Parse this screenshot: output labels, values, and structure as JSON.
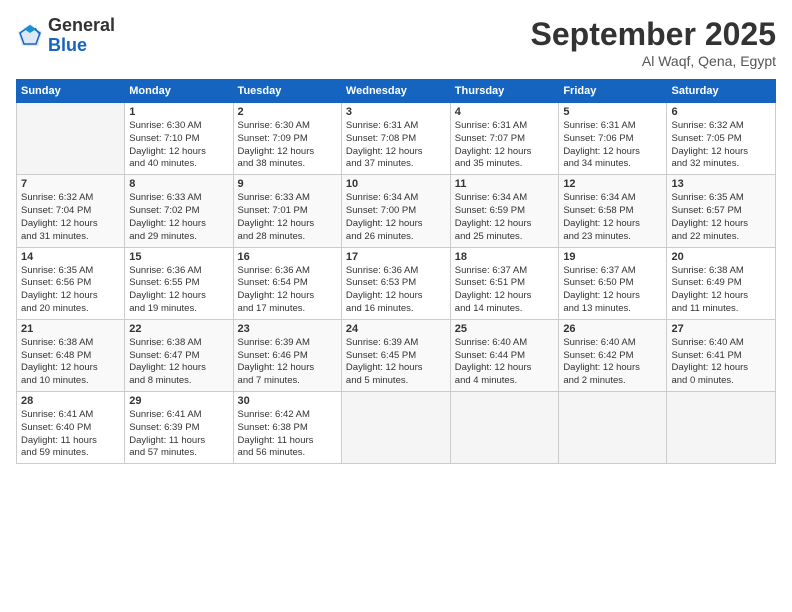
{
  "logo": {
    "general": "General",
    "blue": "Blue"
  },
  "header": {
    "month": "September 2025",
    "location": "Al Waqf, Qena, Egypt"
  },
  "weekdays": [
    "Sunday",
    "Monday",
    "Tuesday",
    "Wednesday",
    "Thursday",
    "Friday",
    "Saturday"
  ],
  "weeks": [
    [
      {
        "day": "",
        "info": ""
      },
      {
        "day": "1",
        "info": "Sunrise: 6:30 AM\nSunset: 7:10 PM\nDaylight: 12 hours\nand 40 minutes."
      },
      {
        "day": "2",
        "info": "Sunrise: 6:30 AM\nSunset: 7:09 PM\nDaylight: 12 hours\nand 38 minutes."
      },
      {
        "day": "3",
        "info": "Sunrise: 6:31 AM\nSunset: 7:08 PM\nDaylight: 12 hours\nand 37 minutes."
      },
      {
        "day": "4",
        "info": "Sunrise: 6:31 AM\nSunset: 7:07 PM\nDaylight: 12 hours\nand 35 minutes."
      },
      {
        "day": "5",
        "info": "Sunrise: 6:31 AM\nSunset: 7:06 PM\nDaylight: 12 hours\nand 34 minutes."
      },
      {
        "day": "6",
        "info": "Sunrise: 6:32 AM\nSunset: 7:05 PM\nDaylight: 12 hours\nand 32 minutes."
      }
    ],
    [
      {
        "day": "7",
        "info": "Sunrise: 6:32 AM\nSunset: 7:04 PM\nDaylight: 12 hours\nand 31 minutes."
      },
      {
        "day": "8",
        "info": "Sunrise: 6:33 AM\nSunset: 7:02 PM\nDaylight: 12 hours\nand 29 minutes."
      },
      {
        "day": "9",
        "info": "Sunrise: 6:33 AM\nSunset: 7:01 PM\nDaylight: 12 hours\nand 28 minutes."
      },
      {
        "day": "10",
        "info": "Sunrise: 6:34 AM\nSunset: 7:00 PM\nDaylight: 12 hours\nand 26 minutes."
      },
      {
        "day": "11",
        "info": "Sunrise: 6:34 AM\nSunset: 6:59 PM\nDaylight: 12 hours\nand 25 minutes."
      },
      {
        "day": "12",
        "info": "Sunrise: 6:34 AM\nSunset: 6:58 PM\nDaylight: 12 hours\nand 23 minutes."
      },
      {
        "day": "13",
        "info": "Sunrise: 6:35 AM\nSunset: 6:57 PM\nDaylight: 12 hours\nand 22 minutes."
      }
    ],
    [
      {
        "day": "14",
        "info": "Sunrise: 6:35 AM\nSunset: 6:56 PM\nDaylight: 12 hours\nand 20 minutes."
      },
      {
        "day": "15",
        "info": "Sunrise: 6:36 AM\nSunset: 6:55 PM\nDaylight: 12 hours\nand 19 minutes."
      },
      {
        "day": "16",
        "info": "Sunrise: 6:36 AM\nSunset: 6:54 PM\nDaylight: 12 hours\nand 17 minutes."
      },
      {
        "day": "17",
        "info": "Sunrise: 6:36 AM\nSunset: 6:53 PM\nDaylight: 12 hours\nand 16 minutes."
      },
      {
        "day": "18",
        "info": "Sunrise: 6:37 AM\nSunset: 6:51 PM\nDaylight: 12 hours\nand 14 minutes."
      },
      {
        "day": "19",
        "info": "Sunrise: 6:37 AM\nSunset: 6:50 PM\nDaylight: 12 hours\nand 13 minutes."
      },
      {
        "day": "20",
        "info": "Sunrise: 6:38 AM\nSunset: 6:49 PM\nDaylight: 12 hours\nand 11 minutes."
      }
    ],
    [
      {
        "day": "21",
        "info": "Sunrise: 6:38 AM\nSunset: 6:48 PM\nDaylight: 12 hours\nand 10 minutes."
      },
      {
        "day": "22",
        "info": "Sunrise: 6:38 AM\nSunset: 6:47 PM\nDaylight: 12 hours\nand 8 minutes."
      },
      {
        "day": "23",
        "info": "Sunrise: 6:39 AM\nSunset: 6:46 PM\nDaylight: 12 hours\nand 7 minutes."
      },
      {
        "day": "24",
        "info": "Sunrise: 6:39 AM\nSunset: 6:45 PM\nDaylight: 12 hours\nand 5 minutes."
      },
      {
        "day": "25",
        "info": "Sunrise: 6:40 AM\nSunset: 6:44 PM\nDaylight: 12 hours\nand 4 minutes."
      },
      {
        "day": "26",
        "info": "Sunrise: 6:40 AM\nSunset: 6:42 PM\nDaylight: 12 hours\nand 2 minutes."
      },
      {
        "day": "27",
        "info": "Sunrise: 6:40 AM\nSunset: 6:41 PM\nDaylight: 12 hours\nand 0 minutes."
      }
    ],
    [
      {
        "day": "28",
        "info": "Sunrise: 6:41 AM\nSunset: 6:40 PM\nDaylight: 11 hours\nand 59 minutes."
      },
      {
        "day": "29",
        "info": "Sunrise: 6:41 AM\nSunset: 6:39 PM\nDaylight: 11 hours\nand 57 minutes."
      },
      {
        "day": "30",
        "info": "Sunrise: 6:42 AM\nSunset: 6:38 PM\nDaylight: 11 hours\nand 56 minutes."
      },
      {
        "day": "",
        "info": ""
      },
      {
        "day": "",
        "info": ""
      },
      {
        "day": "",
        "info": ""
      },
      {
        "day": "",
        "info": ""
      }
    ]
  ]
}
